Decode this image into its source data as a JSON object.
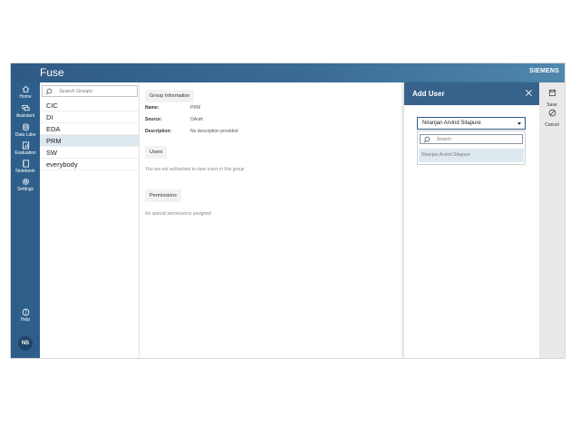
{
  "app": {
    "title": "Fuse",
    "brand": "SIEMENS"
  },
  "nav": {
    "items": [
      {
        "label": "Home",
        "icon": "home-icon"
      },
      {
        "label": "Assistant",
        "icon": "chat-icon"
      },
      {
        "label": "Data Lake",
        "icon": "database-icon"
      },
      {
        "label": "Evaluation",
        "icon": "evaluation-icon"
      },
      {
        "label": "Notebook",
        "icon": "notebook-icon"
      },
      {
        "label": "Settings",
        "icon": "gear-icon"
      }
    ],
    "help": "Help",
    "avatar": "NS"
  },
  "groups": {
    "search_placeholder": "Search Groups",
    "items": [
      "CIC",
      "DI",
      "EDA",
      "PRM",
      "SW",
      "everybody"
    ],
    "selected": "PRM"
  },
  "detail": {
    "group_info_title": "Group Information",
    "name_label": "Name:",
    "name_value": "PRM",
    "source_label": "Source:",
    "source_value": "OAuth",
    "description_label": "Description:",
    "description_value": "No description provided",
    "users_title": "Users",
    "users_message": "You are not authorized to view users in this group",
    "permissions_title": "Permissions",
    "permissions_message": "No special permissions assigned"
  },
  "add_user": {
    "title": "Add User",
    "selected_user": "Niranjan Arvind Sitapure",
    "search_placeholder": "Search",
    "options": [
      "Niranjan Arvind Sitapure"
    ]
  },
  "actions": {
    "save": "Save",
    "cancel": "Cancel"
  },
  "colors": {
    "primary": "#2e5e8a",
    "header": "#36628b",
    "selected_row": "#dde9ef"
  }
}
